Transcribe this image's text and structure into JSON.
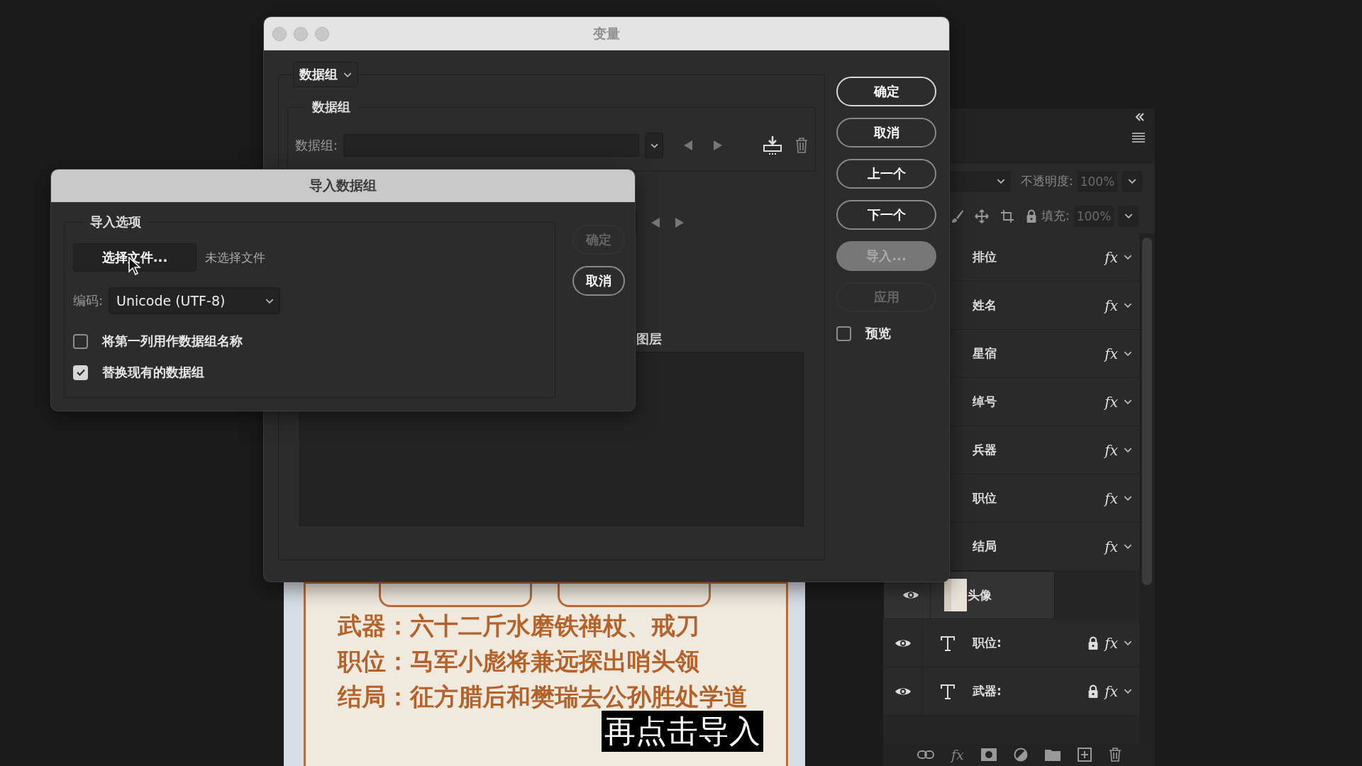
{
  "variables_dialog": {
    "title": "变量",
    "mode_dropdown": "数据组",
    "data_set_group": {
      "legend": "数据组",
      "label": "数据组:"
    },
    "layers_label": "图层",
    "buttons": [
      {
        "label": "确定",
        "default": true,
        "pressed": false,
        "disabled": false
      },
      {
        "label": "取消",
        "default": false,
        "pressed": false,
        "disabled": false
      },
      {
        "label": "上一个",
        "default": false,
        "pressed": false,
        "disabled": false
      },
      {
        "label": "下一个",
        "default": false,
        "pressed": false,
        "disabled": false
      },
      {
        "label": "导入...",
        "default": false,
        "pressed": true,
        "disabled": false
      },
      {
        "label": "应用",
        "default": false,
        "pressed": false,
        "disabled": true
      }
    ],
    "preview": {
      "label": "预览",
      "checked": false
    }
  },
  "import_dialog": {
    "title": "导入数据组",
    "legend": "导入选项",
    "choose_button": "选择文件...",
    "file_status": "未选择文件",
    "encoding": {
      "label": "编码:",
      "value": "Unicode (UTF-8)"
    },
    "options": [
      {
        "label": "将第一列用作数据组名称",
        "checked": false
      },
      {
        "label": "替换现有的数据组",
        "checked": true
      }
    ],
    "buttons": [
      {
        "label": "确定",
        "disabled": true
      },
      {
        "label": "取消",
        "disabled": false
      }
    ]
  },
  "layers_panel": {
    "opacity": {
      "label": "不透明度:",
      "value": "100%"
    },
    "fill": {
      "label": "填充:",
      "value": "100%"
    },
    "layers": [
      {
        "name": "排位",
        "kind": "plain",
        "fx": "fx",
        "locked": false,
        "selected": false
      },
      {
        "name": "姓名",
        "kind": "plain",
        "fx": "fx",
        "locked": false,
        "selected": false
      },
      {
        "name": "星宿",
        "kind": "plain",
        "fx": "fx",
        "locked": false,
        "selected": false
      },
      {
        "name": "绰号",
        "kind": "plain",
        "fx": "fx",
        "locked": false,
        "selected": false
      },
      {
        "name": "兵器",
        "kind": "plain",
        "fx": "fx",
        "locked": false,
        "selected": false
      },
      {
        "name": "职位",
        "kind": "plain",
        "fx": "fx",
        "locked": false,
        "selected": false
      },
      {
        "name": "结局",
        "kind": "plain",
        "fx": "fx",
        "locked": false,
        "selected": false
      },
      {
        "name": "头像",
        "kind": "image",
        "locked": false,
        "selected": true
      },
      {
        "name": "职位:",
        "kind": "text",
        "fx": "fx",
        "locked": true,
        "selected": false
      },
      {
        "name": "武器:",
        "kind": "text",
        "fx": "fx",
        "locked": true,
        "selected": false
      }
    ],
    "toolbar": [
      {
        "kind": "link"
      },
      {
        "kind": "fx",
        "label": "fx"
      },
      {
        "kind": "mask"
      },
      {
        "kind": "adjust"
      },
      {
        "kind": "folder"
      },
      {
        "kind": "new"
      },
      {
        "kind": "trash"
      }
    ]
  },
  "canvas": {
    "lines": [
      "武器：六十二斤水磨铁禅杖、戒刀",
      "职位：马军小彪将兼远探出哨头领",
      "结局：征方腊后和樊瑞去公孙胜处学道"
    ]
  },
  "caption": "再点击导入"
}
